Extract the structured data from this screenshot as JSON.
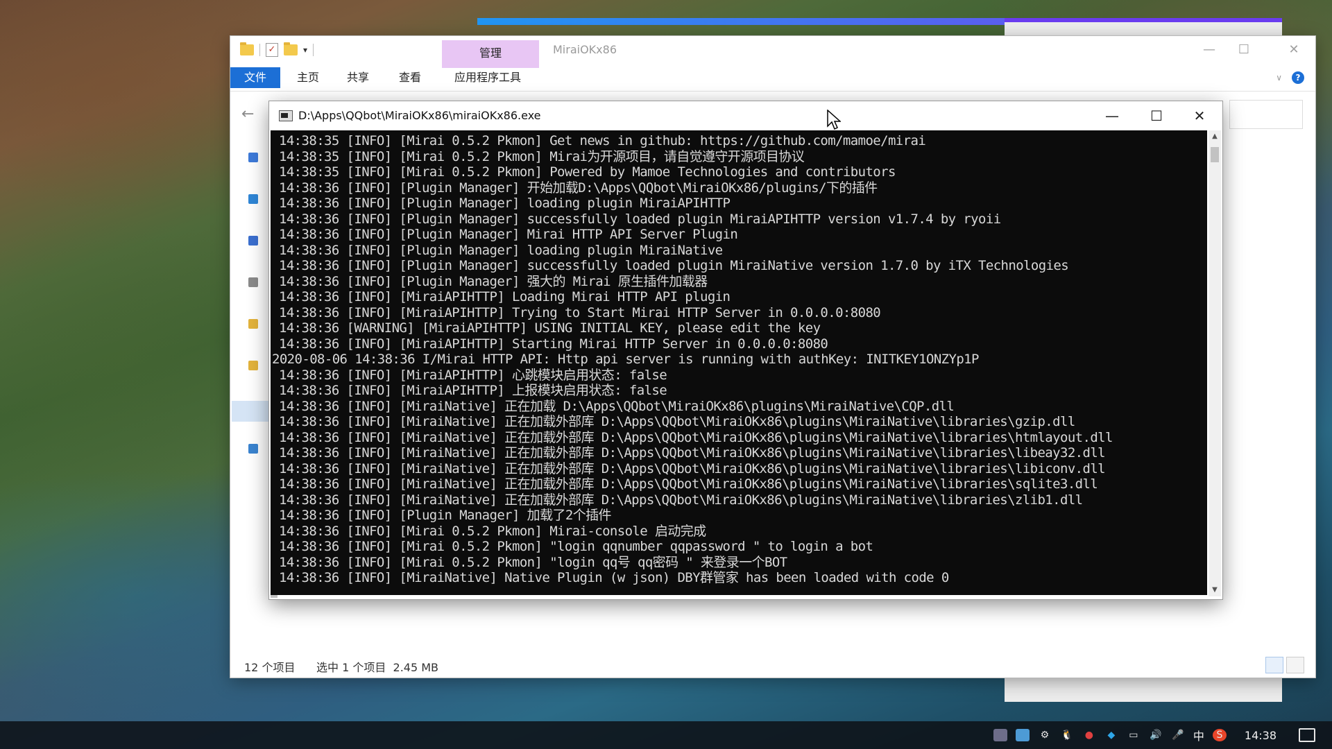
{
  "explorer": {
    "title": "MiraiOKx86",
    "context_tab": "管理",
    "ribbon": [
      "文件",
      "主页",
      "共享",
      "查看",
      "应用程序工具"
    ],
    "status_count": "12 个项目",
    "status_selected": "选中 1 个项目  2.45 MB"
  },
  "console": {
    "title": "D:\\Apps\\QQbot\\MiraiOKx86\\miraiOKx86.exe",
    "lines": [
      "14:38:35 [INFO] [Mirai 0.5.2 Pkmon] Get news in github: https://github.com/mamoe/mirai",
      "14:38:35 [INFO] [Mirai 0.5.2 Pkmon] Mirai为开源项目，请自觉遵守开源项目协议",
      "14:38:35 [INFO] [Mirai 0.5.2 Pkmon] Powered by Mamoe Technologies and contributors",
      "14:38:36 [INFO] [Plugin Manager] 开始加载D:\\Apps\\QQbot\\MiraiOKx86/plugins/下的插件",
      "14:38:36 [INFO] [Plugin Manager] loading plugin MiraiAPIHTTP",
      "14:38:36 [INFO] [Plugin Manager] successfully loaded plugin MiraiAPIHTTP version v1.7.4 by ryoii",
      "14:38:36 [INFO] [Plugin Manager] Mirai HTTP API Server Plugin",
      "14:38:36 [INFO] [Plugin Manager] loading plugin MiraiNative",
      "14:38:36 [INFO] [Plugin Manager] successfully loaded plugin MiraiNative version 1.7.0 by iTX Technologies",
      "14:38:36 [INFO] [Plugin Manager] 强大的 Mirai 原生插件加载器",
      "14:38:36 [INFO] [MiraiAPIHTTP] Loading Mirai HTTP API plugin",
      "14:38:36 [INFO] [MiraiAPIHTTP] Trying to Start Mirai HTTP Server in 0.0.0.0:8080",
      "14:38:36 [WARNING] [MiraiAPIHTTP] USING INITIAL KEY, please edit the key",
      "14:38:36 [INFO] [MiraiAPIHTTP] Starting Mirai HTTP Server in 0.0.0.0:8080",
      "2020-08-06 14:38:36 I/Mirai HTTP API: Http api server is running with authKey: INITKEY1ONZYp1P",
      "14:38:36 [INFO] [MiraiAPIHTTP] 心跳模块启用状态: false",
      "14:38:36 [INFO] [MiraiAPIHTTP] 上报模块启用状态: false",
      "14:38:36 [INFO] [MiraiNative] 正在加载 D:\\Apps\\QQbot\\MiraiOKx86\\plugins\\MiraiNative\\CQP.dll",
      "14:38:36 [INFO] [MiraiNative] 正在加载外部库 D:\\Apps\\QQbot\\MiraiOKx86\\plugins\\MiraiNative\\libraries\\gzip.dll",
      "14:38:36 [INFO] [MiraiNative] 正在加载外部库 D:\\Apps\\QQbot\\MiraiOKx86\\plugins\\MiraiNative\\libraries\\htmlayout.dll",
      "14:38:36 [INFO] [MiraiNative] 正在加载外部库 D:\\Apps\\QQbot\\MiraiOKx86\\plugins\\MiraiNative\\libraries\\libeay32.dll",
      "14:38:36 [INFO] [MiraiNative] 正在加载外部库 D:\\Apps\\QQbot\\MiraiOKx86\\plugins\\MiraiNative\\libraries\\libiconv.dll",
      "14:38:36 [INFO] [MiraiNative] 正在加载外部库 D:\\Apps\\QQbot\\MiraiOKx86\\plugins\\MiraiNative\\libraries\\sqlite3.dll",
      "14:38:36 [INFO] [MiraiNative] 正在加载外部库 D:\\Apps\\QQbot\\MiraiOKx86\\plugins\\MiraiNative\\libraries\\zlib1.dll",
      "14:38:36 [INFO] [Plugin Manager] 加载了2个插件",
      "14:38:36 [INFO] [Mirai 0.5.2 Pkmon] Mirai-console 启动完成",
      "14:38:36 [INFO] [Mirai 0.5.2 Pkmon] \"login qqnumber qqpassword \" to login a bot",
      "14:38:36 [INFO] [Mirai 0.5.2 Pkmon] \"login qq号 qq密码 \" 来登录一个BOT",
      "14:38:36 [INFO] [MiraiNative] Native Plugin (w json) DBY群管家 has been loaded with code 0"
    ]
  },
  "taskbar": {
    "ime": "中",
    "clock": "14:38"
  },
  "colors": {
    "console_bg": "#0c0c0c",
    "console_text": "#d8d8d8",
    "ribbon_file": "#1c6fd6",
    "manage_tab": "#e8c6f4"
  },
  "icons": {
    "window_minimize": "minimize-icon",
    "window_maximize": "maximize-icon",
    "window_close": "close-icon",
    "back": "back-arrow-icon",
    "help": "help-icon"
  }
}
